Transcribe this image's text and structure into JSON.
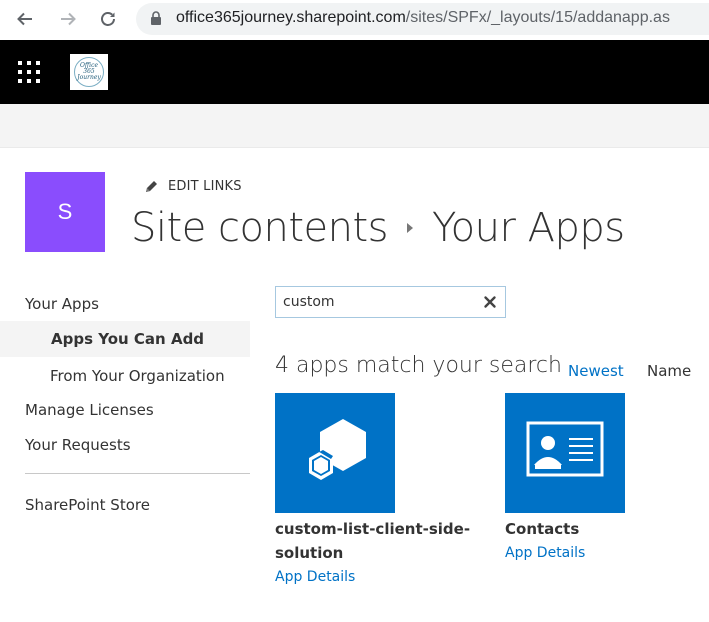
{
  "browser": {
    "url_host": "office365journey.sharepoint.com",
    "url_path": "/sites/SPFx/_layouts/15/addanapp.as"
  },
  "suite": {
    "logo_text_1": "Office 365",
    "logo_text_2": "Journey"
  },
  "site": {
    "logo_letter": "S",
    "edit_links": "EDIT LINKS",
    "breadcrumb": [
      "Site contents",
      "Your Apps"
    ]
  },
  "leftnav": {
    "items": [
      {
        "label": "Your Apps"
      },
      {
        "label": "Apps You Can Add"
      },
      {
        "label": "From Your Organization"
      },
      {
        "label": "Manage Licenses"
      },
      {
        "label": "Your Requests"
      },
      {
        "label": "SharePoint Store"
      }
    ]
  },
  "search": {
    "value": "custom"
  },
  "results": {
    "title": "4 apps match your search",
    "sort_newest": "Newest",
    "sort_name": "Name"
  },
  "apps": [
    {
      "name_line1": "custom-list-client-side-",
      "name_line2": "solution",
      "details": "App Details",
      "icon": "cubes-icon"
    },
    {
      "name_line1": "Contacts",
      "name_line2": "",
      "details": "App Details",
      "icon": "contact-card-icon"
    }
  ],
  "colors": {
    "accent": "#0072c6",
    "site_logo": "#8a4dfd",
    "suite_bar": "#000000"
  }
}
